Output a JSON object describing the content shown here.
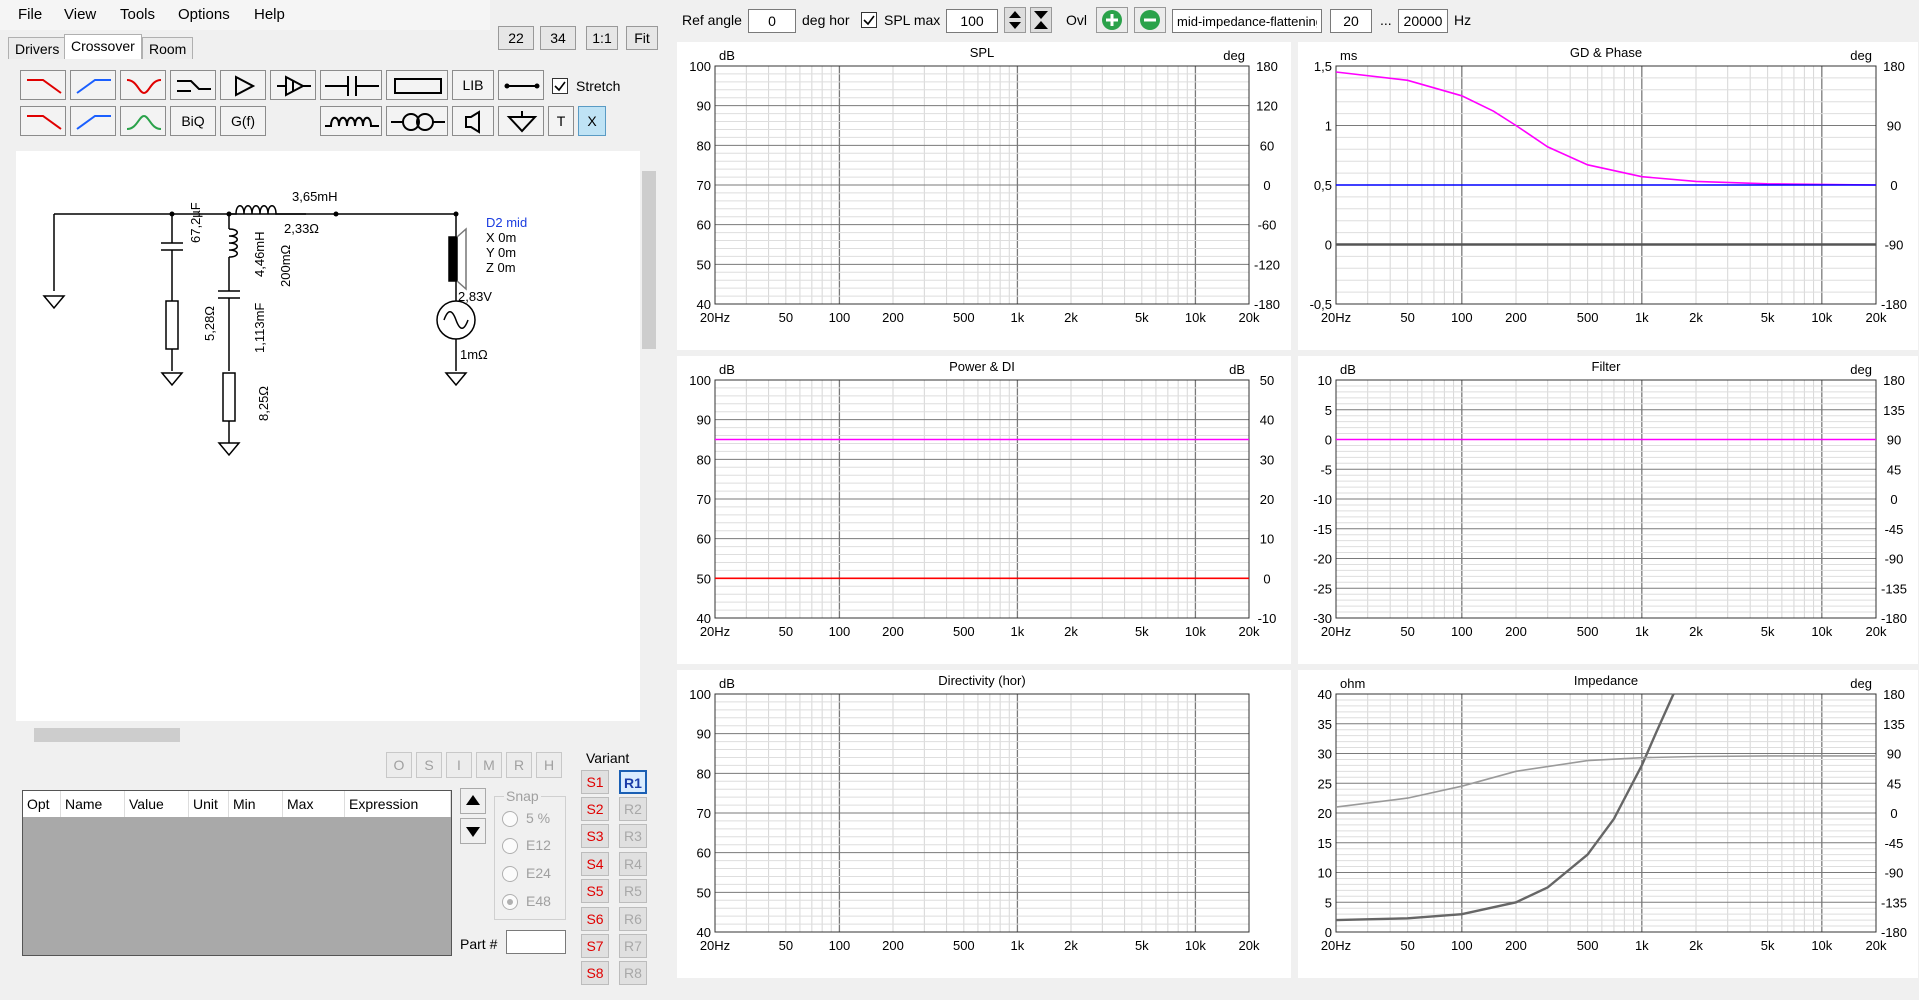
{
  "menu": [
    "File",
    "View",
    "Tools",
    "Options",
    "Help"
  ],
  "tabs": [
    "Drivers",
    "Crossover",
    "Room"
  ],
  "zoom": [
    "22",
    "34",
    "1:1",
    "Fit"
  ],
  "toolbar": {
    "lib": "LIB",
    "biq": "BiQ",
    "gf": "G(f)",
    "t": "T",
    "x": "X",
    "stretch": "Stretch"
  },
  "schematic": {
    "l1": "3,65mH",
    "r_l1": "2,33Ω",
    "c1": "67,2µF",
    "r1": "5,28Ω",
    "l2": "4,46mH",
    "r_l2": "200mΩ",
    "c2": "1,113mF",
    "r2": "8,25Ω",
    "driver": "D2 mid",
    "x": "X 0m",
    "y": "Y 0m",
    "z": "Z 0m",
    "v": "2,83V",
    "rs": "1mΩ"
  },
  "opt_buttons": [
    "O",
    "S",
    "I",
    "M",
    "R",
    "H"
  ],
  "variant": {
    "title": "Variant",
    "s": [
      "S1",
      "S2",
      "S3",
      "S4",
      "S5",
      "S6",
      "S7",
      "S8"
    ],
    "r": [
      "R1",
      "R2",
      "R3",
      "R4",
      "R5",
      "R6",
      "R7",
      "R8"
    ]
  },
  "table_headers": [
    "Opt",
    "Name",
    "Value",
    "Unit",
    "Min",
    "Max",
    "Expression"
  ],
  "snap": {
    "title": "Snap",
    "options": [
      "5 %",
      "E12",
      "E24",
      "E48"
    ],
    "selected": "E48"
  },
  "part_label": "Part #",
  "top": {
    "ref_angle_label": "Ref angle",
    "ref_angle": "0",
    "deg_hor": "deg hor",
    "spl_max_label": "SPL max",
    "spl_max": "100",
    "ovl": "Ovl",
    "name": "mid-impedance-flattening",
    "f_lo": "20",
    "dots": "...",
    "f_hi": "20000",
    "hz": "Hz"
  },
  "colors": {
    "magenta": "#ff00ff",
    "red": "#ff0000",
    "blue": "#0000ff",
    "grey": "#666666",
    "lightgrey": "#9a9a9a",
    "green": "#2aa24a",
    "s_red": "#e00000",
    "r1_blue": "#1a5fb4"
  },
  "chart_data": [
    {
      "title": "SPL",
      "type": "line",
      "left_unit": "dB",
      "right_unit": "deg",
      "left_ticks": [
        "100",
        "90",
        "80",
        "70",
        "60",
        "50",
        "40"
      ],
      "right_ticks": [
        "180",
        "120",
        "60",
        "0",
        "-60",
        "-120",
        "-180"
      ],
      "x_ticks": [
        "20Hz",
        "50",
        "100",
        "200",
        "500",
        "1k",
        "2k",
        "5k",
        "10k",
        "20k"
      ],
      "series": []
    },
    {
      "title": "GD & Phase",
      "type": "line",
      "left_unit": "ms",
      "right_unit": "deg",
      "left_ticks": [
        "1,5",
        "1",
        "0,5",
        "0",
        "-0,5"
      ],
      "right_ticks": [
        "180",
        "90",
        "0",
        "-90",
        "-180"
      ],
      "x_ticks": [
        "20Hz",
        "50",
        "100",
        "200",
        "500",
        "1k",
        "2k",
        "5k",
        "10k",
        "20k"
      ],
      "ylim": [
        -0.5,
        1.5
      ],
      "series": [
        {
          "color": "#ff00ff",
          "axis": "left",
          "x": [
            20,
            50,
            100,
            150,
            200,
            300,
            500,
            1000,
            2000,
            5000,
            10000,
            20000
          ],
          "y": [
            1.45,
            1.38,
            1.25,
            1.12,
            1.0,
            0.82,
            0.67,
            0.57,
            0.53,
            0.51,
            0.505,
            0.5
          ]
        },
        {
          "color": "#0000ff",
          "axis": "left",
          "x": [
            20,
            20000
          ],
          "y": [
            0.5,
            0.5
          ]
        },
        {
          "color": "#555555",
          "axis": "left",
          "x": [
            20,
            20000
          ],
          "y": [
            0,
            0
          ]
        }
      ]
    },
    {
      "title": "Power & DI",
      "type": "line",
      "left_unit": "dB",
      "right_unit": "dB",
      "left_ticks": [
        "100",
        "90",
        "80",
        "70",
        "60",
        "50",
        "40"
      ],
      "right_ticks": [
        "50",
        "40",
        "30",
        "20",
        "10",
        "0",
        "-10"
      ],
      "x_ticks": [
        "20Hz",
        "50",
        "100",
        "200",
        "500",
        "1k",
        "2k",
        "5k",
        "10k",
        "20k"
      ],
      "ylim": [
        40,
        100
      ],
      "series": [
        {
          "color": "#ff00ff",
          "axis": "left",
          "x": [
            20,
            20000
          ],
          "y": [
            85,
            85
          ]
        },
        {
          "color": "#ff0000",
          "axis": "left",
          "x": [
            20,
            20000
          ],
          "y": [
            50,
            50
          ]
        }
      ]
    },
    {
      "title": "Filter",
      "type": "line",
      "left_unit": "dB",
      "right_unit": "deg",
      "left_ticks": [
        "10",
        "5",
        "0",
        "-5",
        "-10",
        "-15",
        "-20",
        "-25",
        "-30"
      ],
      "right_ticks": [
        "180",
        "135",
        "90",
        "45",
        "0",
        "-45",
        "-90",
        "-135",
        "-180"
      ],
      "x_ticks": [
        "20Hz",
        "50",
        "100",
        "200",
        "500",
        "1k",
        "2k",
        "5k",
        "10k",
        "20k"
      ],
      "ylim": [
        -30,
        10
      ],
      "series": [
        {
          "color": "#ff00ff",
          "axis": "left",
          "x": [
            20,
            20000
          ],
          "y": [
            0,
            0
          ]
        }
      ]
    },
    {
      "title": "Directivity (hor)",
      "type": "line",
      "left_unit": "dB",
      "right_unit": "",
      "left_ticks": [
        "100",
        "90",
        "80",
        "70",
        "60",
        "50",
        "40"
      ],
      "right_ticks": [],
      "x_ticks": [
        "20Hz",
        "50",
        "100",
        "200",
        "500",
        "1k",
        "2k",
        "5k",
        "10k",
        "20k"
      ],
      "series": []
    },
    {
      "title": "Impedance",
      "type": "line",
      "left_unit": "ohm",
      "right_unit": "deg",
      "left_ticks": [
        "40",
        "35",
        "30",
        "25",
        "20",
        "15",
        "10",
        "5",
        "0"
      ],
      "right_ticks": [
        "180",
        "135",
        "90",
        "45",
        "0",
        "-45",
        "-90",
        "-135",
        "-180"
      ],
      "x_ticks": [
        "20Hz",
        "50",
        "100",
        "200",
        "500",
        "1k",
        "2k",
        "5k",
        "10k",
        "20k"
      ],
      "ylim": [
        0,
        40
      ],
      "series": [
        {
          "color": "#666666",
          "axis": "left",
          "x": [
            20,
            50,
            100,
            200,
            300,
            500,
            700,
            1000,
            1200,
            1500
          ],
          "y": [
            2.0,
            2.3,
            3.0,
            5.0,
            7.5,
            13.0,
            19.0,
            28.0,
            33.5,
            40.0
          ]
        },
        {
          "color": "#9a9a9a",
          "axis": "left",
          "x": [
            20,
            50,
            100,
            200,
            500,
            1000,
            2000,
            5000,
            20000
          ],
          "y": [
            21.0,
            22.5,
            24.5,
            27.0,
            28.8,
            29.3,
            29.5,
            29.6,
            29.6
          ]
        }
      ]
    }
  ]
}
